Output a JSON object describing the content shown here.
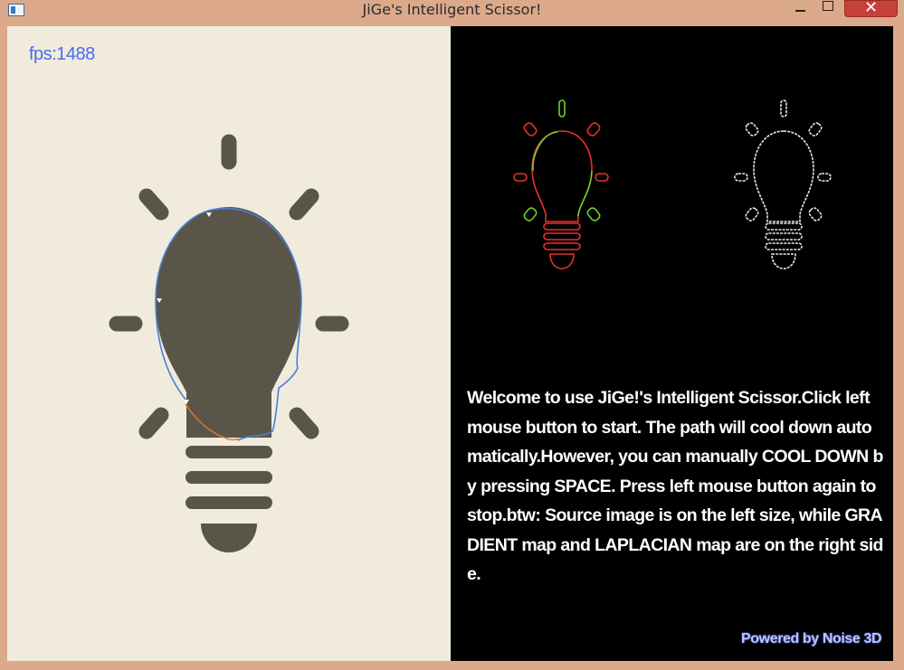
{
  "window": {
    "title": "JiGe's Intelligent Scissor!",
    "close_label": "✕"
  },
  "left_pane": {
    "fps_label": "fps:1488",
    "source_image": "lightbulb-icon"
  },
  "right_pane": {
    "gradient_map": "lightbulb-gradient-outline",
    "laplacian_map": "lightbulb-laplacian-outline",
    "welcome_text": "Welcome to use JiGe!'s Intelligent Scissor.Click left mouse button to start. The path will cool down automatically.However, you can manually COOL DOWN by pressing SPACE. Press left mouse button again to stop.btw: Source image is on the left size, while GRADIENT map and LAPLACIAN map are on the right side.",
    "powered_by": "Powered by Noise 3D"
  },
  "colors": {
    "titlebar": "#dca98a",
    "left_background": "#f0ebdd",
    "bulb_fill": "#5a5549",
    "scissor_path": "#4a7fd6",
    "orange_path": "#e07a2a",
    "gradient_green": "#6cd12a",
    "gradient_red": "#e8312a",
    "close_button": "#c7413a"
  }
}
